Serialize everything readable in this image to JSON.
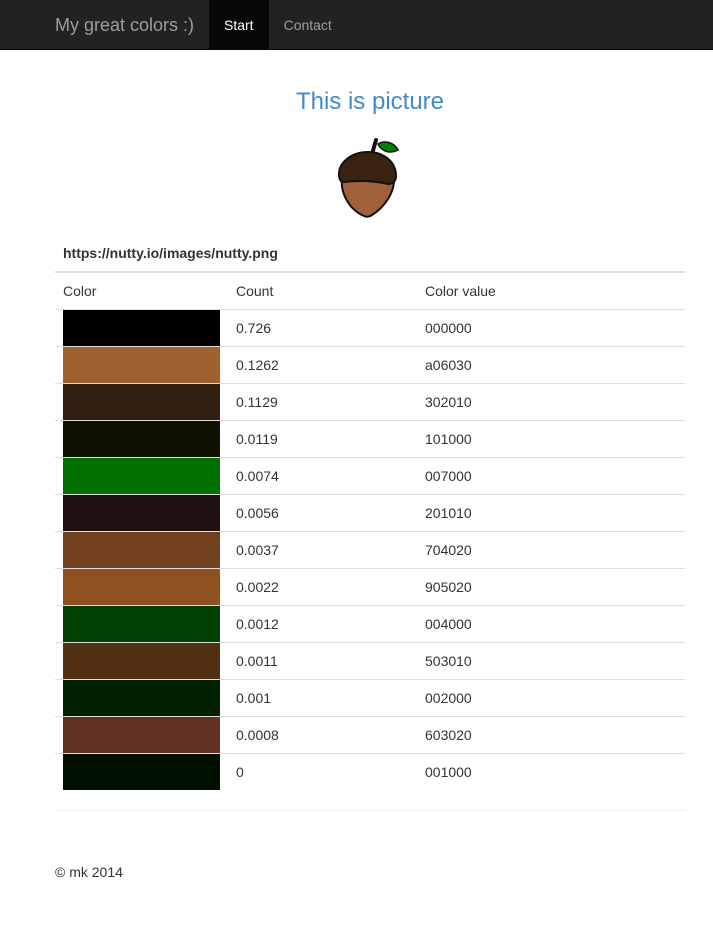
{
  "navbar": {
    "brand": "My great colors :)",
    "items": [
      {
        "label": "Start",
        "active": true
      },
      {
        "label": "Contact",
        "active": false
      }
    ]
  },
  "main": {
    "title": "This is picture",
    "image_icon": "acorn-icon",
    "image_url": "https://nutty.io/images/nutty.png",
    "columns": [
      "Color",
      "Count",
      "Color value"
    ],
    "rows": [
      {
        "count": "0.726",
        "value": "000000",
        "color": "#000000"
      },
      {
        "count": "0.1262",
        "value": "a06030",
        "color": "#a06030"
      },
      {
        "count": "0.1129",
        "value": "302010",
        "color": "#302010"
      },
      {
        "count": "0.0119",
        "value": "101000",
        "color": "#101000"
      },
      {
        "count": "0.0074",
        "value": "007000",
        "color": "#007000"
      },
      {
        "count": "0.0056",
        "value": "201010",
        "color": "#201010"
      },
      {
        "count": "0.0037",
        "value": "704020",
        "color": "#704020"
      },
      {
        "count": "0.0022",
        "value": "905020",
        "color": "#905020"
      },
      {
        "count": "0.0012",
        "value": "004000",
        "color": "#004000"
      },
      {
        "count": "0.0011",
        "value": "503010",
        "color": "#503010"
      },
      {
        "count": "0.001",
        "value": "002000",
        "color": "#002000"
      },
      {
        "count": "0.0008",
        "value": "603020",
        "color": "#603020"
      },
      {
        "count": "0",
        "value": "001000",
        "color": "#001000"
      }
    ]
  },
  "footer": {
    "text": "© mk 2014"
  },
  "colors": {
    "navbar_bg": "#222222",
    "active_nav_bg": "#080808",
    "title": "#428bca",
    "acorn_cap": "#3b2314",
    "acorn_nut": "#a0603a",
    "acorn_leaf": "#008000"
  }
}
